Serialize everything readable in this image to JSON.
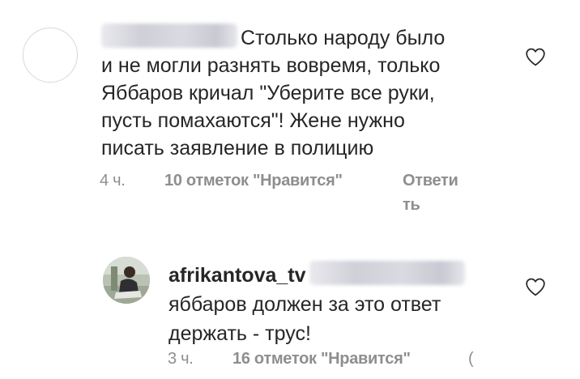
{
  "comment1": {
    "text_lines": [
      "Столько народу было",
      "и не могли разнять вовремя, только",
      "Яббаров кричал \"Уберите все руки,",
      "пусть помахаются\"! Жене нужно",
      "писать заявление в полицию"
    ],
    "time": "4 ч.",
    "likes": "10 отметок \"Нравится\"",
    "reply_line1": "Ответи",
    "reply_line2": "ть"
  },
  "comment2": {
    "username": "afrikantova_tv",
    "text_line1": "яббаров должен за это ответ",
    "text_line2": "держать - трус!",
    "time": "3 ч.",
    "likes": "16 отметок \"Нравится\"",
    "reply_cut": "("
  },
  "icons": {
    "heart": "heart-outline-icon"
  },
  "colors": {
    "text": "#262626",
    "meta": "#8e8e8e",
    "background": "#ffffff"
  }
}
